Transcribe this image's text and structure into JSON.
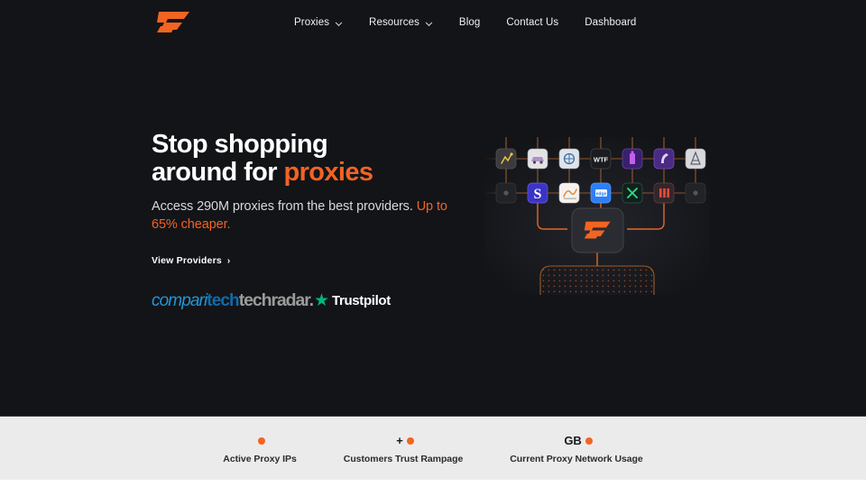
{
  "brand": {
    "logo_icon": "rampage-r-logo",
    "accent_color": "#f26422",
    "dark_bg": "#131418",
    "stats_bg": "#ebebeb"
  },
  "nav": {
    "items": [
      {
        "label": "Proxies",
        "has_chevron": true,
        "icon": "chevron-down-icon"
      },
      {
        "label": "Resources",
        "has_chevron": true,
        "icon": "chevron-down-icon"
      },
      {
        "label": "Blog",
        "has_chevron": false,
        "icon": ""
      },
      {
        "label": "Contact Us",
        "has_chevron": false,
        "icon": ""
      },
      {
        "label": "Dashboard",
        "has_chevron": false,
        "icon": ""
      }
    ]
  },
  "hero": {
    "headline_line1": "Stop shopping",
    "headline_line2_plain": "around for ",
    "headline_line2_accent": "proxies",
    "subcopy_plain": "Access 290M proxies from the best providers. ",
    "subcopy_accent": "Up to 65% cheaper.",
    "cta_label": "View Providers",
    "cta_arrow": "›"
  },
  "badges": {
    "comparitech_light": "compari",
    "comparitech_bold": "tech",
    "techradar": "techradar.",
    "trustpilot_star": "★",
    "trustpilot_name": "Trustpilot"
  },
  "diagram": {
    "center_icon": "rampage-r-logo",
    "row_top_tiles": [
      "tile-chart-icon",
      "tile-car-icon",
      "tile-network-icon",
      "tile-wtf-icon",
      "tile-purple-bottle-icon",
      "tile-purple-lamp-icon",
      "tile-grey-tower-icon"
    ],
    "row_mid_tiles": [
      "tile-node-dot-left",
      "tile-smartproxy-s-icon",
      "tile-light-card-icon",
      "tile-blue-bright-icon",
      "tile-x-green-icon",
      "tile-red-bars-icon",
      "tile-node-dot-right"
    ],
    "grid_panel": "dotted-grid-panel"
  },
  "stats": {
    "items": [
      {
        "prefix": "",
        "number": "",
        "suffix": "",
        "label": "Active Proxy IPs"
      },
      {
        "prefix": "",
        "number": "",
        "suffix": "+",
        "label": "Customers Trust Rampage"
      },
      {
        "prefix": "",
        "number": "",
        "suffix": "GB",
        "label": "Current Proxy Network Usage"
      }
    ]
  }
}
